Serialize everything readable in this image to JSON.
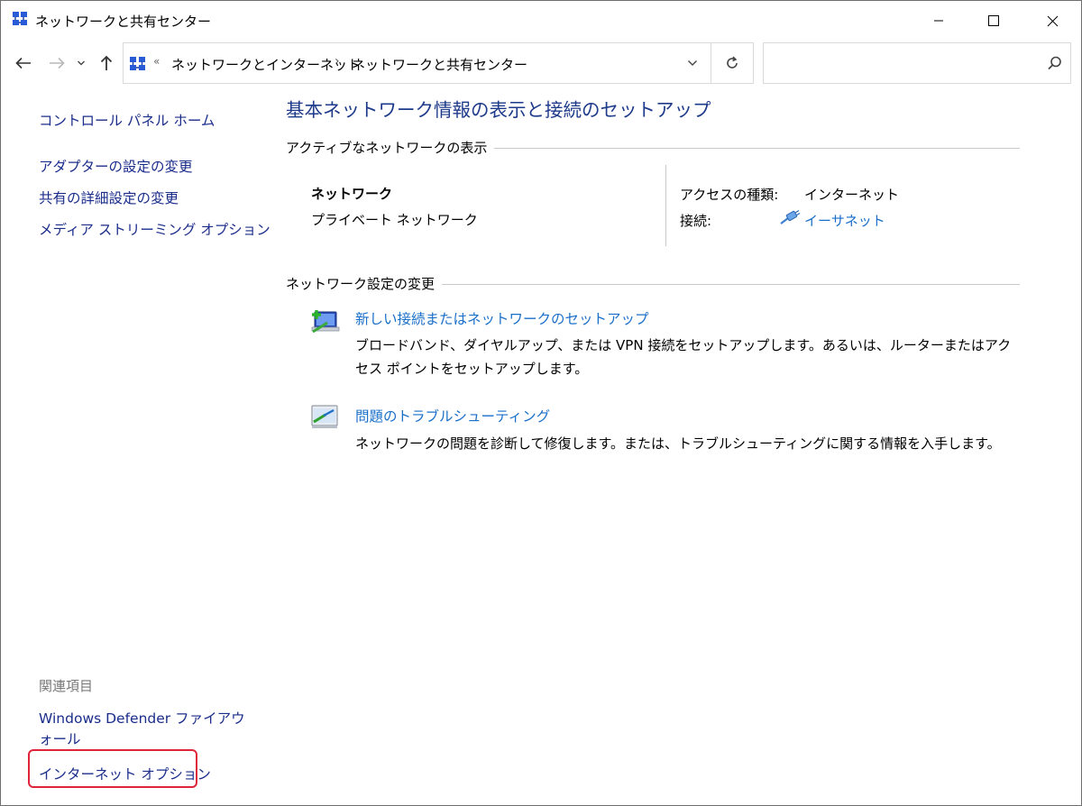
{
  "window": {
    "title": "ネットワークと共有センター"
  },
  "address_bar": {
    "overflow_chevron": "«",
    "crumbs": [
      "ネットワークとインターネット",
      "ネットワークと共有センター"
    ],
    "separator": "›"
  },
  "search": {
    "placeholder": ""
  },
  "sidebar": {
    "home": "コントロール パネル ホーム",
    "links": [
      "アダプターの設定の変更",
      "共有の詳細設定の変更",
      "メディア ストリーミング オプション"
    ],
    "related_heading": "関連項目",
    "related_links": [
      "Windows Defender ファイアウォール",
      "インターネット オプション"
    ]
  },
  "main": {
    "title": "基本ネットワーク情報の表示と接続のセットアップ",
    "active_networks": {
      "heading": "アクティブなネットワークの表示",
      "network_name": "ネットワーク",
      "network_type": "プライベート ネットワーク",
      "access_label": "アクセスの種類:",
      "access_value": "インターネット",
      "connection_label": "接続:",
      "connection_value": "イーサネット"
    },
    "change_settings": {
      "heading": "ネットワーク設定の変更",
      "tasks": [
        {
          "title": "新しい接続またはネットワークのセットアップ",
          "description": "ブロードバンド、ダイヤルアップ、または VPN 接続をセットアップします。あるいは、ルーターまたはアクセス ポイントをセットアップします。",
          "icon": "new-connection-icon"
        },
        {
          "title": "問題のトラブルシューティング",
          "description": "ネットワークの問題を診断して修復します。または、トラブルシューティングに関する情報を入手します。",
          "icon": "troubleshoot-icon"
        }
      ]
    }
  },
  "colors": {
    "link_dark": "#1b2d8b",
    "link_blue": "#1a6fc9",
    "title_blue": "#1e3a8a",
    "highlight": "#e0253a"
  }
}
